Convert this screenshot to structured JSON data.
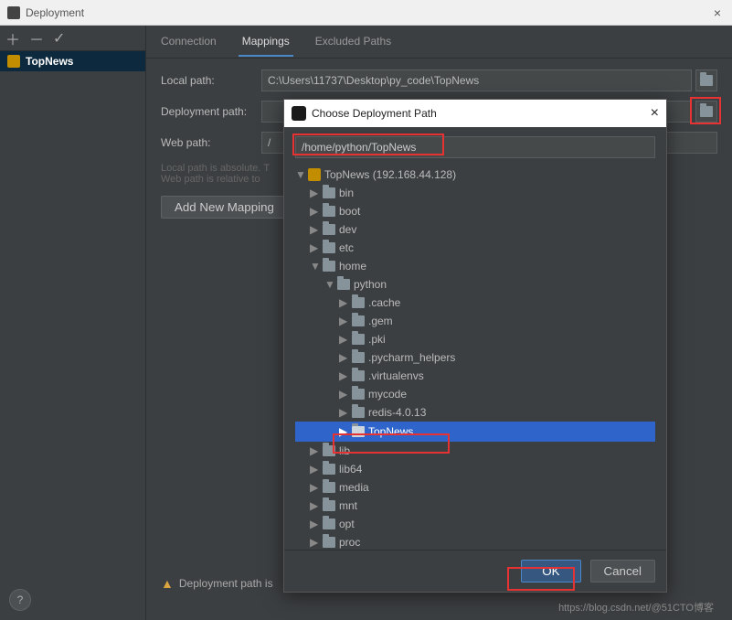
{
  "window": {
    "title": "Deployment",
    "close": "×"
  },
  "toolbar": {
    "add": "＋",
    "remove": "－",
    "check": "✓"
  },
  "sidebar": {
    "server_name": "TopNews"
  },
  "tabs": {
    "connection": "Connection",
    "mappings": "Mappings",
    "excluded": "Excluded Paths"
  },
  "form": {
    "local_label": "Local path:",
    "local_value": "C:\\Users\\11737\\Desktop\\py_code\\TopNews",
    "deploy_label": "Deployment path:",
    "web_label": "Web path:",
    "web_value": "/",
    "hint1": "Local path is absolute. T",
    "hint2": "Web path is relative to",
    "add_mapping": "Add New Mapping"
  },
  "warning": "Deployment path is",
  "dialog": {
    "title": "Choose Deployment Path",
    "close": "×",
    "path_value": "/home/python/TopNews",
    "root": "TopNews (192.168.44.128)",
    "tree": {
      "bin": "bin",
      "boot": "boot",
      "dev": "dev",
      "etc": "etc",
      "home": "home",
      "python": "python",
      "cache": ".cache",
      "gem": ".gem",
      "pki": ".pki",
      "pycharm": ".pycharm_helpers",
      "venv": ".virtualenvs",
      "mycode": "mycode",
      "redis": "redis-4.0.13",
      "topnews": "TopNews",
      "lib": "lib",
      "lib64": "lib64",
      "media": "media",
      "mnt": "mnt",
      "opt": "opt",
      "proc": "proc"
    },
    "ok": "OK",
    "cancel": "Cancel"
  },
  "help": "?",
  "watermark": "https://blog.csdn.net/@51CTO博客"
}
